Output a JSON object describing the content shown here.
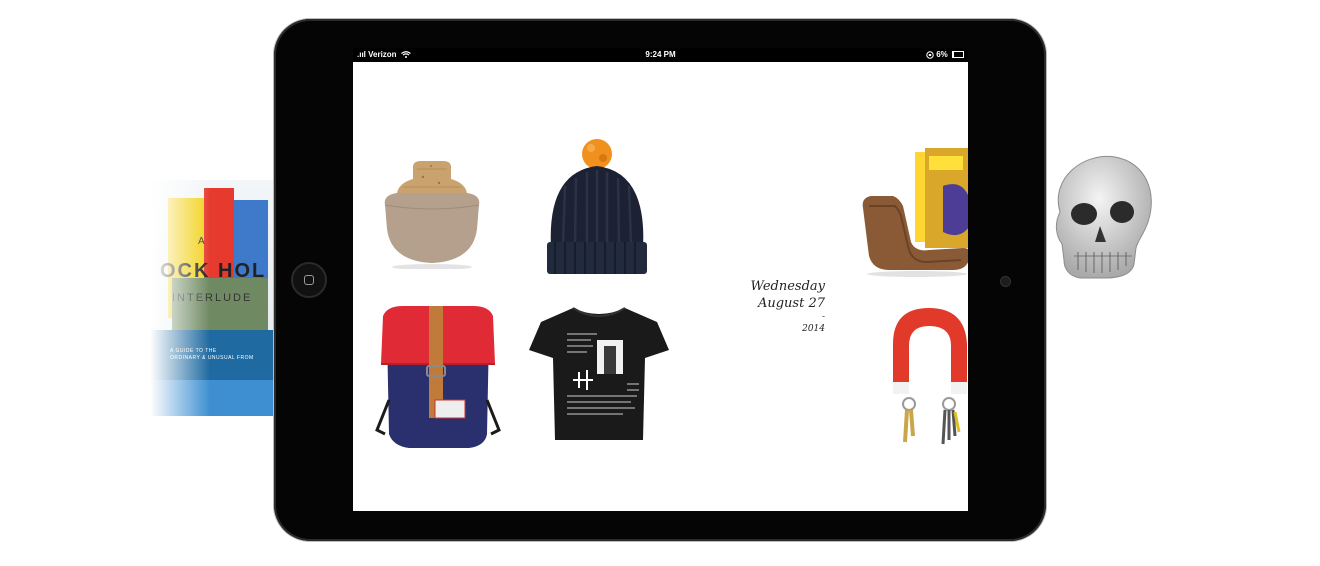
{
  "background": {
    "book": {
      "title_small": "A",
      "title_main": "OCK HOL",
      "subtitle": "INTERLUDE",
      "blurb": "A GUIDE TO THE\nORDINARY & UNUSUAL FROM",
      "colors": [
        "#f2d21c",
        "#e63a2e",
        "#3f79c9",
        "#6f8a63",
        "#1f6aa1"
      ]
    },
    "skull_icon": "skull"
  },
  "device": {
    "status_bar": {
      "carrier": ".ııl Verizon",
      "wifi_icon": "wifi",
      "time": "9:24 PM",
      "battery_percent": "6%",
      "rotation_lock_icon": "rotation-lock",
      "battery_icon": "battery"
    },
    "home_button_icon": "home-square"
  },
  "screen": {
    "products": [
      {
        "id": "cork-vessel",
        "name": "cork-lid-ceramic-jar"
      },
      {
        "id": "beanie",
        "name": "pom-pom-beanie"
      },
      {
        "id": "backpack",
        "name": "red-navy-backpack"
      },
      {
        "id": "tshirt",
        "name": "black-graphic-tshirt"
      },
      {
        "id": "magazine-rack",
        "name": "bentwood-magazine-rack"
      },
      {
        "id": "magnet",
        "name": "horseshoe-magnet-key-holder"
      }
    ],
    "date": {
      "weekday": "Wednesday",
      "month_day": "August 27",
      "separator": "-",
      "year": "2014"
    }
  },
  "colors": {
    "bezel": "#050505",
    "screen_bg": "#ffffff",
    "beanie_pom": "#f0901d",
    "backpack_red": "#e02a36",
    "backpack_navy": "#2a2f6e",
    "strap_tan": "#c07a3a",
    "magnet_red": "#e23a2a"
  }
}
